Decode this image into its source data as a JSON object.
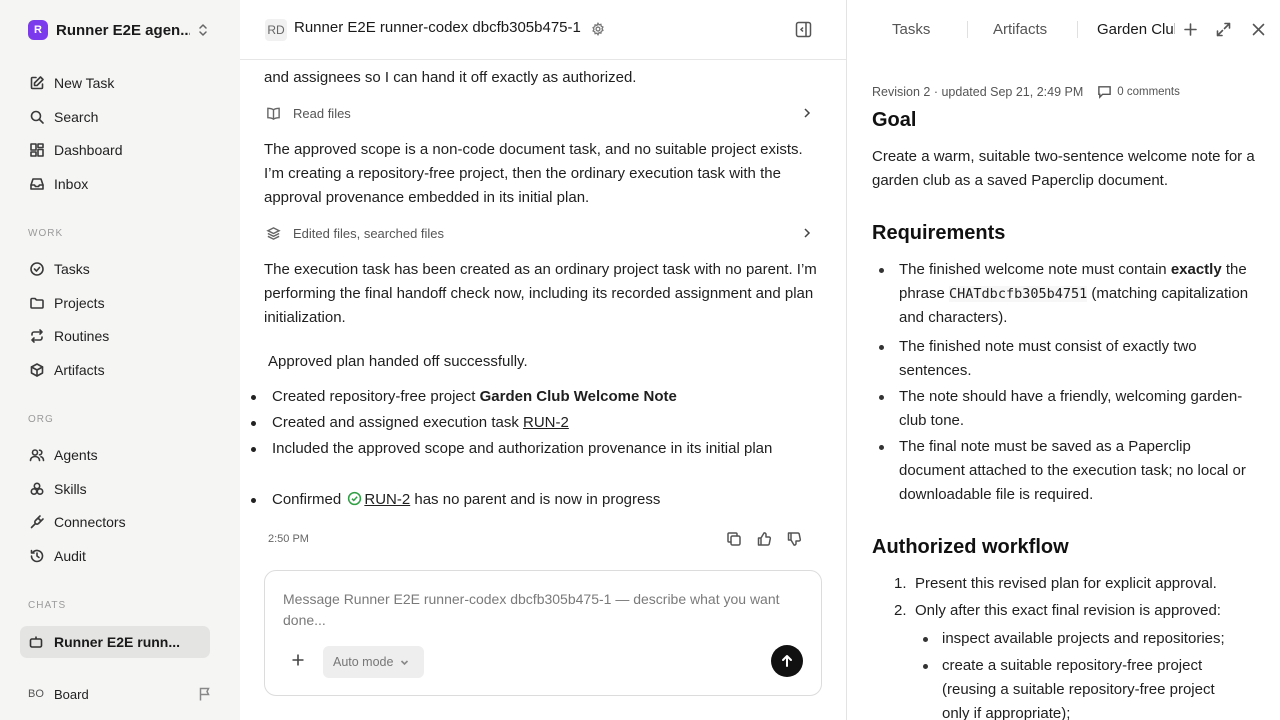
{
  "workspace": {
    "logo_letter": "R",
    "name": "Runner E2E agen..."
  },
  "nav_main": [
    {
      "label": "New Task",
      "icon": "edit-icon"
    },
    {
      "label": "Search",
      "icon": "search-icon"
    },
    {
      "label": "Dashboard",
      "icon": "dashboard-icon"
    },
    {
      "label": "Inbox",
      "icon": "inbox-icon"
    }
  ],
  "sections": {
    "work": "WORK",
    "org": "ORG",
    "chats": "CHATS"
  },
  "nav_work": [
    {
      "label": "Tasks",
      "icon": "check-circle-icon"
    },
    {
      "label": "Projects",
      "icon": "folder-icon"
    },
    {
      "label": "Routines",
      "icon": "repeat-icon"
    },
    {
      "label": "Artifacts",
      "icon": "box-icon"
    }
  ],
  "nav_org": [
    {
      "label": "Agents",
      "icon": "users-icon"
    },
    {
      "label": "Skills",
      "icon": "skills-icon"
    },
    {
      "label": "Connectors",
      "icon": "plug-icon"
    },
    {
      "label": "Audit",
      "icon": "history-icon"
    }
  ],
  "chats": [
    {
      "label": "Runner E2E runn..."
    }
  ],
  "footer": {
    "initials": "BO",
    "label": "Board"
  },
  "chat": {
    "initials": "RD",
    "title": "Runner E2E runner-codex dbcfb305b475-1",
    "msg_top": "and assignees so I can hand it off exactly as authorized.",
    "tool_read": "Read files",
    "msg_scope": "The approved scope is a non-code document task, and no suitable project exists. I’m creating a repository-free project, then the ordinary execution task with the approval provenance embedded in its initial plan.",
    "tool_edit": "Edited files, searched files",
    "msg_exec": "The execution task has been created as an ordinary project task with no parent. I’m performing the final handoff check now, including its recorded assignment and plan initialization.",
    "handoff_title": "Approved plan handed off successfully.",
    "bullets": {
      "b1_text": "Created repository-free project ",
      "b1_bold": "Garden Club Welcome Note",
      "b2_text": "Created and assigned execution task ",
      "b2_link": "RUN-2",
      "b3_text": "Included the approved scope and authorization provenance in its initial plan",
      "b4_text": "Confirmed ",
      "b4_link": "RUN-2",
      "b4_tail": " has no parent and is now in progress"
    },
    "timestamp": "2:50 PM",
    "composer_placeholder": "Message Runner E2E runner-codex dbcfb305b475-1 — describe what you want done...",
    "mode_label": "Auto mode"
  },
  "panel": {
    "tabs": [
      "Tasks",
      "Artifacts",
      "Garden Club"
    ],
    "revision": "Revision 2 · updated Sep 21, 2:49 PM",
    "comments": "0 comments",
    "goal_h": "Goal",
    "goal_text": "Create a warm, suitable two-sentence welcome note for a garden club as a saved Paperclip document.",
    "req_h": "Requirements",
    "req": {
      "r1_a": "The finished welcome note must contain ",
      "r1_bold": "exactly",
      "r1_b": " the phrase ",
      "r1_code": "CHATdbcfb305b4751",
      "r1_c": " (matching capitalization and characters).",
      "r2": "The finished note must consist of exactly two sentences.",
      "r3": "The note should have a friendly, welcoming garden-club tone.",
      "r4": "The final note must be saved as a Paperclip document attached to the execution task; no local or downloadable file is required."
    },
    "wf_h": "Authorized workflow",
    "wf": {
      "n1": "1.",
      "s1": "Present this revised plan for explicit approval.",
      "n2": "2.",
      "s2": "Only after this exact final revision is approved:",
      "sub1": "inspect available projects and repositories;",
      "sub2": "create a suitable repository-free project (reusing a suitable repository-free project only if appropriate);"
    }
  }
}
